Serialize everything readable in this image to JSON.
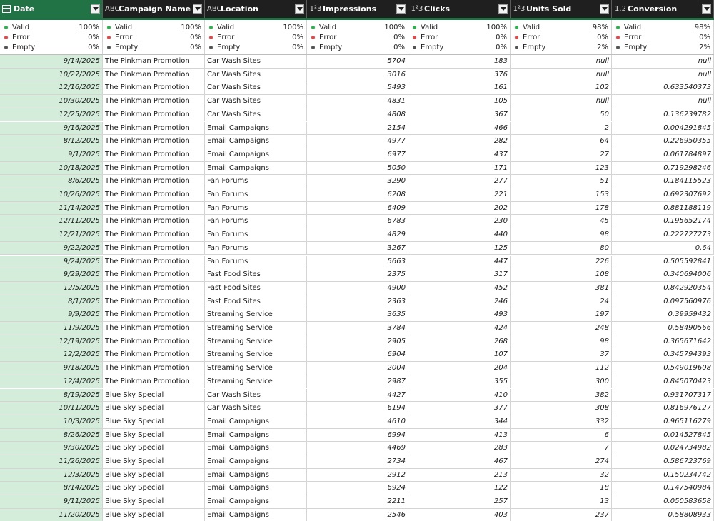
{
  "columns": [
    {
      "key": "date",
      "type_icon": "table-icon",
      "type_label": "",
      "title": "Date",
      "align": "r",
      "quality": {
        "valid": "100%",
        "error": "0%",
        "empty": "0%"
      }
    },
    {
      "key": "campaign",
      "type_icon": "text-type-icon",
      "type_label": "ABC",
      "title": "Campaign Name",
      "align": "l",
      "quality": {
        "valid": "100%",
        "error": "0%",
        "empty": "0%"
      }
    },
    {
      "key": "location",
      "type_icon": "text-type-icon",
      "type_label": "ABC",
      "title": "Location",
      "align": "l",
      "quality": {
        "valid": "100%",
        "error": "0%",
        "empty": "0%"
      }
    },
    {
      "key": "impressions",
      "type_icon": "whole-number-type-icon",
      "type_label": "1²3",
      "title": "Impressions",
      "align": "r",
      "quality": {
        "valid": "100%",
        "error": "0%",
        "empty": "0%"
      }
    },
    {
      "key": "clicks",
      "type_icon": "whole-number-type-icon",
      "type_label": "1²3",
      "title": "Clicks",
      "align": "r",
      "quality": {
        "valid": "100%",
        "error": "0%",
        "empty": "0%"
      }
    },
    {
      "key": "units_sold",
      "type_icon": "whole-number-type-icon",
      "type_label": "1²3",
      "title": "Units Sold",
      "align": "r",
      "quality": {
        "valid": "98%",
        "error": "0%",
        "empty": "2%"
      }
    },
    {
      "key": "conversion",
      "type_icon": "decimal-type-icon",
      "type_label": "1.2",
      "title": "Conversion",
      "align": "r",
      "quality": {
        "valid": "98%",
        "error": "0%",
        "empty": "2%"
      }
    }
  ],
  "quality_labels": {
    "valid": "Valid",
    "error": "Error",
    "empty": "Empty"
  },
  "rows": [
    [
      "9/14/2025",
      "The Pinkman Promotion",
      "Car Wash Sites",
      "5704",
      "183",
      "null",
      "null"
    ],
    [
      "10/27/2025",
      "The Pinkman Promotion",
      "Car Wash Sites",
      "3016",
      "376",
      "null",
      "null"
    ],
    [
      "12/16/2025",
      "The Pinkman Promotion",
      "Car Wash Sites",
      "5493",
      "161",
      "102",
      "0.633540373"
    ],
    [
      "10/30/2025",
      "The Pinkman Promotion",
      "Car Wash Sites",
      "4831",
      "105",
      "null",
      "null"
    ],
    [
      "12/25/2025",
      "The Pinkman Promotion",
      "Car Wash Sites",
      "4808",
      "367",
      "50",
      "0.136239782"
    ],
    [
      "9/16/2025",
      "The Pinkman Promotion",
      "Email Campaigns",
      "2154",
      "466",
      "2",
      "0.004291845"
    ],
    [
      "8/12/2025",
      "The Pinkman Promotion",
      "Email Campaigns",
      "4977",
      "282",
      "64",
      "0.226950355"
    ],
    [
      "9/1/2025",
      "The Pinkman Promotion",
      "Email Campaigns",
      "6977",
      "437",
      "27",
      "0.061784897"
    ],
    [
      "10/18/2025",
      "The Pinkman Promotion",
      "Email Campaigns",
      "5050",
      "171",
      "123",
      "0.719298246"
    ],
    [
      "8/6/2025",
      "The Pinkman Promotion",
      "Fan Forums",
      "3290",
      "277",
      "51",
      "0.184115523"
    ],
    [
      "10/26/2025",
      "The Pinkman Promotion",
      "Fan Forums",
      "6208",
      "221",
      "153",
      "0.692307692"
    ],
    [
      "11/14/2025",
      "The Pinkman Promotion",
      "Fan Forums",
      "6409",
      "202",
      "178",
      "0.881188119"
    ],
    [
      "12/11/2025",
      "The Pinkman Promotion",
      "Fan Forums",
      "6783",
      "230",
      "45",
      "0.195652174"
    ],
    [
      "12/21/2025",
      "The Pinkman Promotion",
      "Fan Forums",
      "4829",
      "440",
      "98",
      "0.222727273"
    ],
    [
      "9/22/2025",
      "The Pinkman Promotion",
      "Fan Forums",
      "3267",
      "125",
      "80",
      "0.64"
    ],
    [
      "9/24/2025",
      "The Pinkman Promotion",
      "Fan Forums",
      "5663",
      "447",
      "226",
      "0.505592841"
    ],
    [
      "9/29/2025",
      "The Pinkman Promotion",
      "Fast Food Sites",
      "2375",
      "317",
      "108",
      "0.340694006"
    ],
    [
      "12/5/2025",
      "The Pinkman Promotion",
      "Fast Food Sites",
      "4900",
      "452",
      "381",
      "0.842920354"
    ],
    [
      "8/1/2025",
      "The Pinkman Promotion",
      "Fast Food Sites",
      "2363",
      "246",
      "24",
      "0.097560976"
    ],
    [
      "9/9/2025",
      "The Pinkman Promotion",
      "Streaming Service",
      "3635",
      "493",
      "197",
      "0.39959432"
    ],
    [
      "11/9/2025",
      "The Pinkman Promotion",
      "Streaming Service",
      "3784",
      "424",
      "248",
      "0.58490566"
    ],
    [
      "12/19/2025",
      "The Pinkman Promotion",
      "Streaming Service",
      "2905",
      "268",
      "98",
      "0.365671642"
    ],
    [
      "12/2/2025",
      "The Pinkman Promotion",
      "Streaming Service",
      "6904",
      "107",
      "37",
      "0.345794393"
    ],
    [
      "9/18/2025",
      "The Pinkman Promotion",
      "Streaming Service",
      "2004",
      "204",
      "112",
      "0.549019608"
    ],
    [
      "12/4/2025",
      "The Pinkman Promotion",
      "Streaming Service",
      "2987",
      "355",
      "300",
      "0.845070423"
    ],
    [
      "8/19/2025",
      "Blue Sky Special",
      "Car Wash Sites",
      "4427",
      "410",
      "382",
      "0.931707317"
    ],
    [
      "10/11/2025",
      "Blue Sky Special",
      "Car Wash Sites",
      "6194",
      "377",
      "308",
      "0.816976127"
    ],
    [
      "10/3/2025",
      "Blue Sky Special",
      "Email Campaigns",
      "4610",
      "344",
      "332",
      "0.965116279"
    ],
    [
      "8/26/2025",
      "Blue Sky Special",
      "Email Campaigns",
      "6994",
      "413",
      "6",
      "0.014527845"
    ],
    [
      "9/30/2025",
      "Blue Sky Special",
      "Email Campaigns",
      "4469",
      "283",
      "7",
      "0.024734982"
    ],
    [
      "11/26/2025",
      "Blue Sky Special",
      "Email Campaigns",
      "2734",
      "467",
      "274",
      "0.586723769"
    ],
    [
      "12/3/2025",
      "Blue Sky Special",
      "Email Campaigns",
      "2912",
      "213",
      "32",
      "0.150234742"
    ],
    [
      "8/14/2025",
      "Blue Sky Special",
      "Email Campaigns",
      "6924",
      "122",
      "18",
      "0.147540984"
    ],
    [
      "9/11/2025",
      "Blue Sky Special",
      "Email Campaigns",
      "2211",
      "257",
      "13",
      "0.050583658"
    ],
    [
      "11/20/2025",
      "Blue Sky Special",
      "Email Campaigns",
      "2546",
      "403",
      "237",
      "0.58808933"
    ]
  ]
}
